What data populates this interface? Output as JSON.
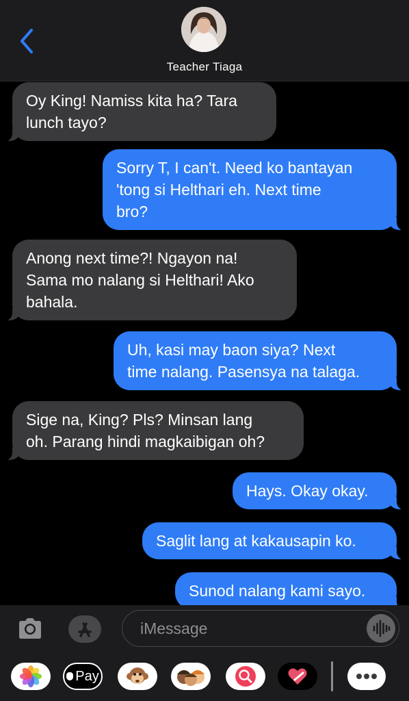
{
  "header": {
    "contact_name": "Teacher Tiaga",
    "back_icon": "chevron-left-icon",
    "accent": "#2f7cf6"
  },
  "messages": [
    {
      "direction": "incoming",
      "text": "Oy King! Namiss kita ha? Tara\nlunch tayo?"
    },
    {
      "direction": "outgoing",
      "text": "Sorry T, I can't. Need ko bantayan\n'tong si Helthari eh. Next time\nbro?"
    },
    {
      "direction": "incoming",
      "text": "Anong next time?! Ngayon na!\nSama mo nalang si Helthari! Ako\nbahala."
    },
    {
      "direction": "outgoing",
      "text": "Uh, kasi may baon siya? Next\ntime nalang. Pasensya na talaga."
    },
    {
      "direction": "incoming",
      "text": "Sige na, King? Pls? Minsan lang\noh. Parang hindi magkaibigan oh?"
    },
    {
      "direction": "outgoing",
      "text": "Hays. Okay okay."
    },
    {
      "direction": "outgoing",
      "text": "Saglit lang at kakausapin ko."
    },
    {
      "direction": "outgoing",
      "text": "Sunod nalang kami sayo."
    }
  ],
  "composer": {
    "placeholder": "iMessage",
    "camera_icon": "camera-icon",
    "apps_icon": "app-store-icon",
    "audio_icon": "waveform-icon"
  },
  "app_tray": {
    "items": [
      {
        "name": "photos-app-icon"
      },
      {
        "name": "apple-pay-app-icon",
        "label": "Pay"
      },
      {
        "name": "animoji-app-icon"
      },
      {
        "name": "memoji-app-icon"
      },
      {
        "name": "image-search-app-icon"
      },
      {
        "name": "digital-touch-app-icon"
      },
      {
        "name": "more-apps-icon"
      }
    ]
  },
  "colors": {
    "incoming_bubble": "#3a3a3c",
    "outgoing_bubble": "#2f7cf6",
    "background": "#000000"
  }
}
